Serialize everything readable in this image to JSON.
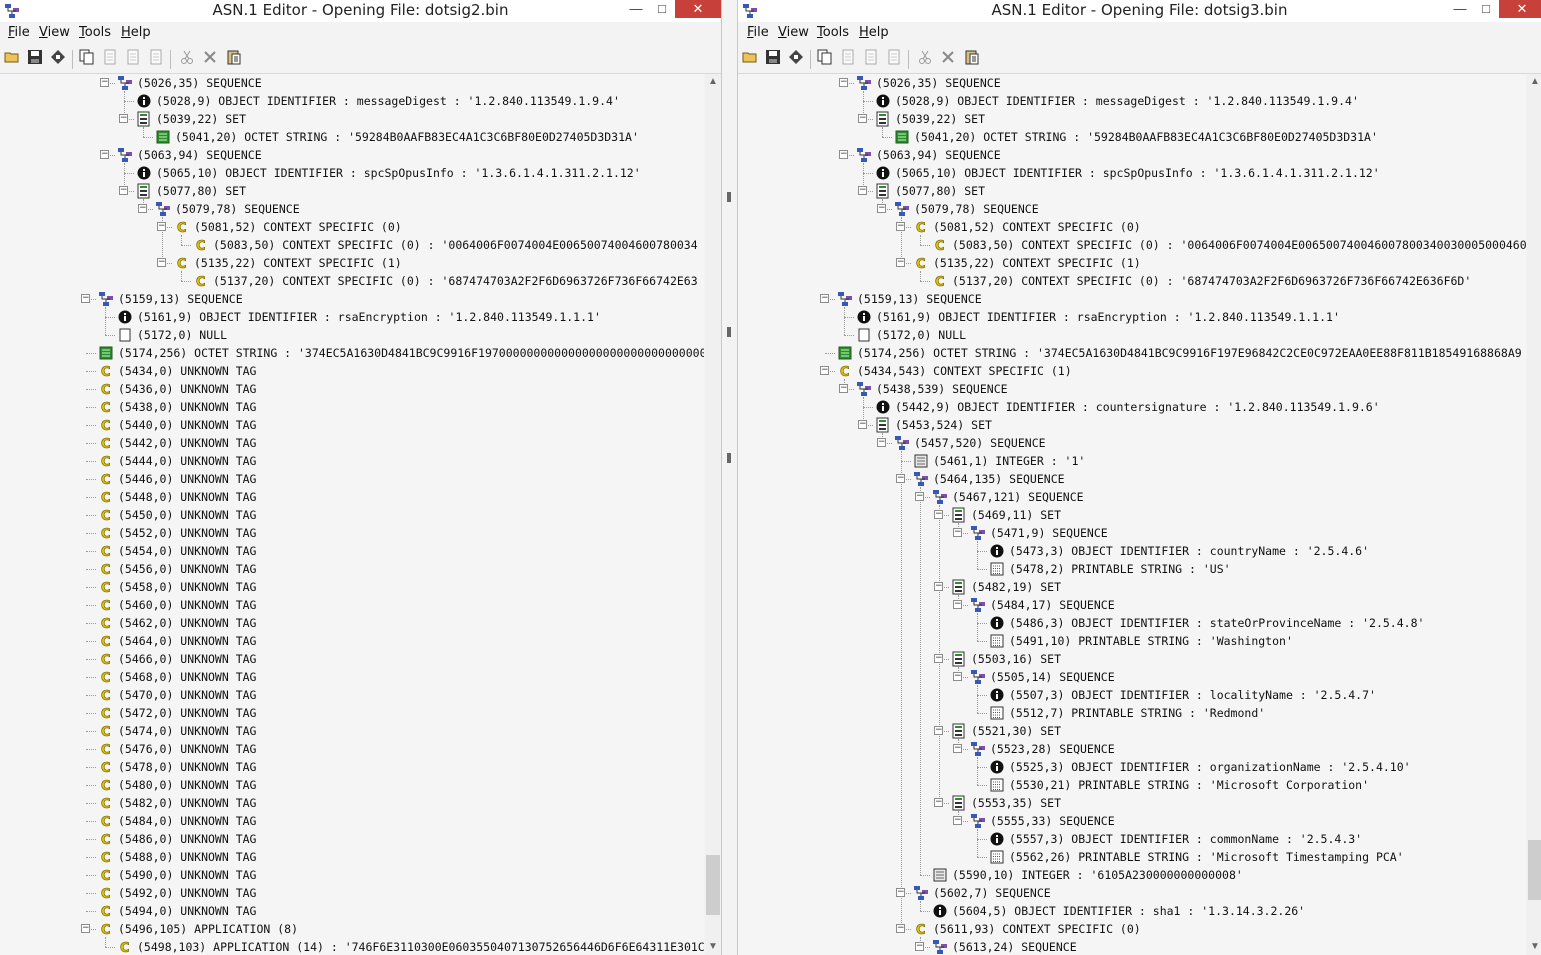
{
  "windows": [
    {
      "id": "left",
      "title": "ASN.1 Editor - Opening File: dotsig2.bin",
      "menu": [
        "File",
        "View",
        "Tools",
        "Help"
      ],
      "controls": {
        "minimize": "—",
        "maximize": "□",
        "close": "✕"
      },
      "scroll": {
        "position_fraction": 0.97
      },
      "tree": [
        {
          "depth": 1,
          "toggle": true,
          "icon": "sequence",
          "text": "(5026,35) SEQUENCE"
        },
        {
          "depth": 2,
          "toggle": false,
          "icon": "oid",
          "text": "(5028,9) OBJECT IDENTIFIER : messageDigest : '1.2.840.113549.1.9.4'"
        },
        {
          "depth": 2,
          "toggle": true,
          "icon": "set",
          "text": "(5039,22) SET"
        },
        {
          "depth": 3,
          "toggle": false,
          "icon": "octet",
          "text": "(5041,20) OCTET STRING : '59284B0AAFB83EC4A1C3C6BF80E0D27405D3D31A'"
        },
        {
          "depth": 1,
          "toggle": true,
          "icon": "sequence",
          "text": "(5063,94) SEQUENCE"
        },
        {
          "depth": 2,
          "toggle": false,
          "icon": "oid",
          "text": "(5065,10) OBJECT IDENTIFIER : spcSpOpusInfo : '1.3.6.1.4.1.311.2.1.12'"
        },
        {
          "depth": 2,
          "toggle": true,
          "icon": "set",
          "text": "(5077,80) SET"
        },
        {
          "depth": 3,
          "toggle": true,
          "icon": "sequence",
          "text": "(5079,78) SEQUENCE"
        },
        {
          "depth": 4,
          "toggle": true,
          "icon": "context",
          "text": "(5081,52) CONTEXT SPECIFIC (0)"
        },
        {
          "depth": 5,
          "toggle": false,
          "icon": "context",
          "text": "(5083,50) CONTEXT SPECIFIC (0) : '0064006F0074004E00650074004600780034"
        },
        {
          "depth": 4,
          "toggle": true,
          "icon": "context",
          "text": "(5135,22) CONTEXT SPECIFIC (1)"
        },
        {
          "depth": 5,
          "toggle": false,
          "icon": "context",
          "text": "(5137,20) CONTEXT SPECIFIC (0) : '687474703A2F2F6D6963726F736F66742E63"
        },
        {
          "depth": 0,
          "toggle": true,
          "icon": "sequence",
          "text": "(5159,13) SEQUENCE"
        },
        {
          "depth": 1,
          "toggle": false,
          "icon": "oid",
          "text": "(5161,9) OBJECT IDENTIFIER : rsaEncryption : '1.2.840.113549.1.1.1'"
        },
        {
          "depth": 1,
          "toggle": false,
          "icon": "null",
          "text": "(5172,0) NULL"
        },
        {
          "depth": 0,
          "toggle": false,
          "icon": "octet",
          "text": "(5174,256) OCTET STRING : '374EC5A1630D4841BC9C9916F197000000000000000000000000000000"
        },
        {
          "depth": 0,
          "toggle": false,
          "icon": "context",
          "text": "(5434,0) UNKNOWN TAG"
        },
        {
          "depth": 0,
          "toggle": false,
          "icon": "context",
          "text": "(5436,0) UNKNOWN TAG"
        },
        {
          "depth": 0,
          "toggle": false,
          "icon": "context",
          "text": "(5438,0) UNKNOWN TAG"
        },
        {
          "depth": 0,
          "toggle": false,
          "icon": "context",
          "text": "(5440,0) UNKNOWN TAG"
        },
        {
          "depth": 0,
          "toggle": false,
          "icon": "context",
          "text": "(5442,0) UNKNOWN TAG"
        },
        {
          "depth": 0,
          "toggle": false,
          "icon": "context",
          "text": "(5444,0) UNKNOWN TAG"
        },
        {
          "depth": 0,
          "toggle": false,
          "icon": "context",
          "text": "(5446,0) UNKNOWN TAG"
        },
        {
          "depth": 0,
          "toggle": false,
          "icon": "context",
          "text": "(5448,0) UNKNOWN TAG"
        },
        {
          "depth": 0,
          "toggle": false,
          "icon": "context",
          "text": "(5450,0) UNKNOWN TAG"
        },
        {
          "depth": 0,
          "toggle": false,
          "icon": "context",
          "text": "(5452,0) UNKNOWN TAG"
        },
        {
          "depth": 0,
          "toggle": false,
          "icon": "context",
          "text": "(5454,0) UNKNOWN TAG"
        },
        {
          "depth": 0,
          "toggle": false,
          "icon": "context",
          "text": "(5456,0) UNKNOWN TAG"
        },
        {
          "depth": 0,
          "toggle": false,
          "icon": "context",
          "text": "(5458,0) UNKNOWN TAG"
        },
        {
          "depth": 0,
          "toggle": false,
          "icon": "context",
          "text": "(5460,0) UNKNOWN TAG"
        },
        {
          "depth": 0,
          "toggle": false,
          "icon": "context",
          "text": "(5462,0) UNKNOWN TAG"
        },
        {
          "depth": 0,
          "toggle": false,
          "icon": "context",
          "text": "(5464,0) UNKNOWN TAG"
        },
        {
          "depth": 0,
          "toggle": false,
          "icon": "context",
          "text": "(5466,0) UNKNOWN TAG"
        },
        {
          "depth": 0,
          "toggle": false,
          "icon": "context",
          "text": "(5468,0) UNKNOWN TAG"
        },
        {
          "depth": 0,
          "toggle": false,
          "icon": "context",
          "text": "(5470,0) UNKNOWN TAG"
        },
        {
          "depth": 0,
          "toggle": false,
          "icon": "context",
          "text": "(5472,0) UNKNOWN TAG"
        },
        {
          "depth": 0,
          "toggle": false,
          "icon": "context",
          "text": "(5474,0) UNKNOWN TAG"
        },
        {
          "depth": 0,
          "toggle": false,
          "icon": "context",
          "text": "(5476,0) UNKNOWN TAG"
        },
        {
          "depth": 0,
          "toggle": false,
          "icon": "context",
          "text": "(5478,0) UNKNOWN TAG"
        },
        {
          "depth": 0,
          "toggle": false,
          "icon": "context",
          "text": "(5480,0) UNKNOWN TAG"
        },
        {
          "depth": 0,
          "toggle": false,
          "icon": "context",
          "text": "(5482,0) UNKNOWN TAG"
        },
        {
          "depth": 0,
          "toggle": false,
          "icon": "context",
          "text": "(5484,0) UNKNOWN TAG"
        },
        {
          "depth": 0,
          "toggle": false,
          "icon": "context",
          "text": "(5486,0) UNKNOWN TAG"
        },
        {
          "depth": 0,
          "toggle": false,
          "icon": "context",
          "text": "(5488,0) UNKNOWN TAG"
        },
        {
          "depth": 0,
          "toggle": false,
          "icon": "context",
          "text": "(5490,0) UNKNOWN TAG"
        },
        {
          "depth": 0,
          "toggle": false,
          "icon": "context",
          "text": "(5492,0) UNKNOWN TAG"
        },
        {
          "depth": 0,
          "toggle": false,
          "icon": "context",
          "text": "(5494,0) UNKNOWN TAG"
        },
        {
          "depth": 0,
          "toggle": true,
          "icon": "context",
          "text": "(5496,105) APPLICATION (8)"
        },
        {
          "depth": 1,
          "toggle": false,
          "icon": "context",
          "text": "(5498,103) APPLICATION (14) : '746F6E3110300E0603550407130752656446D6F6E64311E301C"
        }
      ]
    },
    {
      "id": "right",
      "title": "ASN.1 Editor - Opening File: dotsig3.bin",
      "menu": [
        "File",
        "View",
        "Tools",
        "Help"
      ],
      "controls": {
        "minimize": "—",
        "maximize": "□",
        "close": "✕"
      },
      "scroll": {
        "position_fraction": 0.95
      },
      "tree": [
        {
          "depth": 1,
          "toggle": true,
          "icon": "sequence",
          "text": "(5026,35) SEQUENCE"
        },
        {
          "depth": 2,
          "toggle": false,
          "icon": "oid",
          "text": "(5028,9) OBJECT IDENTIFIER : messageDigest : '1.2.840.113549.1.9.4'"
        },
        {
          "depth": 2,
          "toggle": true,
          "icon": "set",
          "text": "(5039,22) SET"
        },
        {
          "depth": 3,
          "toggle": false,
          "icon": "octet",
          "text": "(5041,20) OCTET STRING : '59284B0AAFB83EC4A1C3C6BF80E0D27405D3D31A'"
        },
        {
          "depth": 1,
          "toggle": true,
          "icon": "sequence",
          "text": "(5063,94) SEQUENCE"
        },
        {
          "depth": 2,
          "toggle": false,
          "icon": "oid",
          "text": "(5065,10) OBJECT IDENTIFIER : spcSpOpusInfo : '1.3.6.1.4.1.311.2.1.12'"
        },
        {
          "depth": 2,
          "toggle": true,
          "icon": "set",
          "text": "(5077,80) SET"
        },
        {
          "depth": 3,
          "toggle": true,
          "icon": "sequence",
          "text": "(5079,78) SEQUENCE"
        },
        {
          "depth": 4,
          "toggle": true,
          "icon": "context",
          "text": "(5081,52) CONTEXT SPECIFIC (0)"
        },
        {
          "depth": 5,
          "toggle": false,
          "icon": "context",
          "text": "(5083,50) CONTEXT SPECIFIC (0) : '0064006F0074004E00650074004600780034003000500046004600"
        },
        {
          "depth": 4,
          "toggle": true,
          "icon": "context",
          "text": "(5135,22) CONTEXT SPECIFIC (1)"
        },
        {
          "depth": 5,
          "toggle": false,
          "icon": "context",
          "text": "(5137,20) CONTEXT SPECIFIC (0) : '687474703A2F2F6D6963726F736F66742E636F6D'"
        },
        {
          "depth": 0,
          "toggle": true,
          "icon": "sequence",
          "text": "(5159,13) SEQUENCE"
        },
        {
          "depth": 1,
          "toggle": false,
          "icon": "oid",
          "text": "(5161,9) OBJECT IDENTIFIER : rsaEncryption : '1.2.840.113549.1.1.1'"
        },
        {
          "depth": 1,
          "toggle": false,
          "icon": "null",
          "text": "(5172,0) NULL"
        },
        {
          "depth": 0,
          "toggle": false,
          "icon": "octet",
          "text": "(5174,256) OCTET STRING : '374EC5A1630D4841BC9C9916F197E96842C2CE0C972EAA0EE88F811B18549168868A9"
        },
        {
          "depth": 0,
          "toggle": true,
          "icon": "context",
          "text": "(5434,543) CONTEXT SPECIFIC (1)"
        },
        {
          "depth": 1,
          "toggle": true,
          "icon": "sequence",
          "text": "(5438,539) SEQUENCE"
        },
        {
          "depth": 2,
          "toggle": false,
          "icon": "oid",
          "text": "(5442,9) OBJECT IDENTIFIER : countersignature : '1.2.840.113549.1.9.6'"
        },
        {
          "depth": 2,
          "toggle": true,
          "icon": "set",
          "text": "(5453,524) SET"
        },
        {
          "depth": 3,
          "toggle": true,
          "icon": "sequence",
          "text": "(5457,520) SEQUENCE"
        },
        {
          "depth": 4,
          "toggle": false,
          "icon": "integer",
          "text": "(5461,1) INTEGER : '1'"
        },
        {
          "depth": 4,
          "toggle": true,
          "icon": "sequence",
          "text": "(5464,135) SEQUENCE"
        },
        {
          "depth": 5,
          "toggle": true,
          "icon": "sequence",
          "text": "(5467,121) SEQUENCE"
        },
        {
          "depth": 6,
          "toggle": true,
          "icon": "set",
          "text": "(5469,11) SET"
        },
        {
          "depth": 7,
          "toggle": true,
          "icon": "sequence",
          "text": "(5471,9) SEQUENCE"
        },
        {
          "depth": 8,
          "toggle": false,
          "icon": "oid",
          "text": "(5473,3) OBJECT IDENTIFIER : countryName : '2.5.4.6'"
        },
        {
          "depth": 8,
          "toggle": false,
          "icon": "printable",
          "text": "(5478,2) PRINTABLE STRING : 'US'"
        },
        {
          "depth": 6,
          "toggle": true,
          "icon": "set",
          "text": "(5482,19) SET"
        },
        {
          "depth": 7,
          "toggle": true,
          "icon": "sequence",
          "text": "(5484,17) SEQUENCE"
        },
        {
          "depth": 8,
          "toggle": false,
          "icon": "oid",
          "text": "(5486,3) OBJECT IDENTIFIER : stateOrProvinceName : '2.5.4.8'"
        },
        {
          "depth": 8,
          "toggle": false,
          "icon": "printable",
          "text": "(5491,10) PRINTABLE STRING : 'Washington'"
        },
        {
          "depth": 6,
          "toggle": true,
          "icon": "set",
          "text": "(5503,16) SET"
        },
        {
          "depth": 7,
          "toggle": true,
          "icon": "sequence",
          "text": "(5505,14) SEQUENCE"
        },
        {
          "depth": 8,
          "toggle": false,
          "icon": "oid",
          "text": "(5507,3) OBJECT IDENTIFIER : localityName : '2.5.4.7'"
        },
        {
          "depth": 8,
          "toggle": false,
          "icon": "printable",
          "text": "(5512,7) PRINTABLE STRING : 'Redmond'"
        },
        {
          "depth": 6,
          "toggle": true,
          "icon": "set",
          "text": "(5521,30) SET"
        },
        {
          "depth": 7,
          "toggle": true,
          "icon": "sequence",
          "text": "(5523,28) SEQUENCE"
        },
        {
          "depth": 8,
          "toggle": false,
          "icon": "oid",
          "text": "(5525,3) OBJECT IDENTIFIER : organizationName : '2.5.4.10'"
        },
        {
          "depth": 8,
          "toggle": false,
          "icon": "printable",
          "text": "(5530,21) PRINTABLE STRING : 'Microsoft Corporation'"
        },
        {
          "depth": 6,
          "toggle": true,
          "icon": "set",
          "text": "(5553,35) SET"
        },
        {
          "depth": 7,
          "toggle": true,
          "icon": "sequence",
          "text": "(5555,33) SEQUENCE"
        },
        {
          "depth": 8,
          "toggle": false,
          "icon": "oid",
          "text": "(5557,3) OBJECT IDENTIFIER : commonName : '2.5.4.3'"
        },
        {
          "depth": 8,
          "toggle": false,
          "icon": "printable",
          "text": "(5562,26) PRINTABLE STRING : 'Microsoft Timestamping PCA'"
        },
        {
          "depth": 5,
          "toggle": false,
          "icon": "integer",
          "text": "(5590,10) INTEGER : '6105A230000000000008'"
        },
        {
          "depth": 4,
          "toggle": true,
          "icon": "sequence",
          "text": "(5602,7) SEQUENCE"
        },
        {
          "depth": 5,
          "toggle": false,
          "icon": "oid",
          "text": "(5604,5) OBJECT IDENTIFIER : sha1 : '1.3.14.3.2.26'"
        },
        {
          "depth": 4,
          "toggle": true,
          "icon": "context",
          "text": "(5611,93) CONTEXT SPECIFIC (0)"
        },
        {
          "depth": 5,
          "toggle": true,
          "icon": "sequence",
          "text": "(5613,24) SEQUENCE"
        }
      ]
    }
  ],
  "toolbar_icons": [
    "open-folder-icon",
    "save-icon",
    "save-as-icon",
    "copy-icon",
    "page-icon",
    "page-icon",
    "page-icon",
    "cut-icon",
    "delete-icon",
    "paste-icon"
  ],
  "colors": {
    "octet_green": "#2e8b2e",
    "context_yellow": "#e0c200",
    "sequence_blue": "#3858b8",
    "close_red": "#c7403a"
  }
}
